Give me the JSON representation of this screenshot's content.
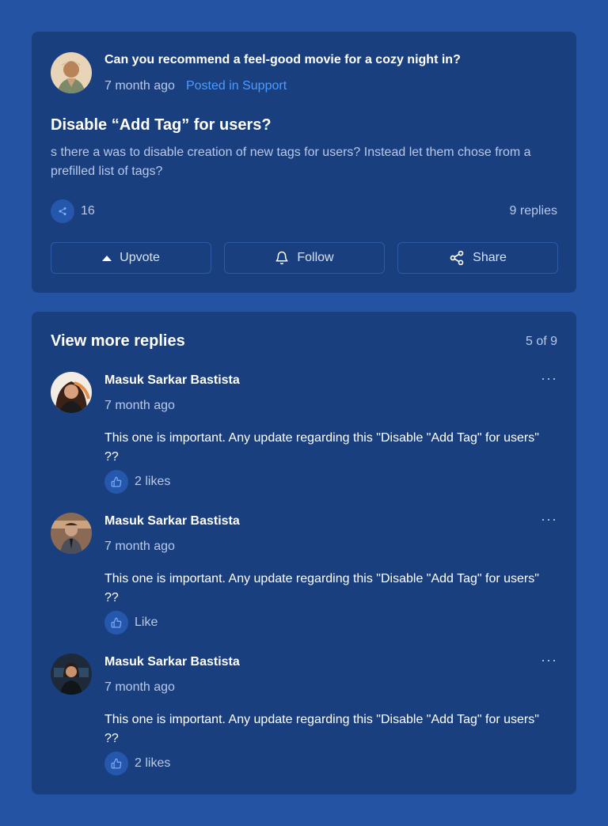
{
  "post": {
    "question": "Can you recommend a feel-good movie for a cozy night in?",
    "time": "7 month ago",
    "posted_in": "Posted in Support",
    "title": "Disable “Add Tag” for users?",
    "body": "s there a was to disable creation of new tags for users? Instead let them chose from a prefilled list of tags?",
    "share_count": "16",
    "replies_count": "9 replies",
    "actions": {
      "upvote": "Upvote",
      "follow": "Follow",
      "share": "Share"
    }
  },
  "replies_section": {
    "title": "View more replies",
    "pager": "5 of 9",
    "replies": [
      {
        "name": "Masuk Sarkar Bastista",
        "time": "7 month ago",
        "text": "This one is important. Any update regarding this \"Disable \"Add Tag\" for users\" ??",
        "likes": "2 likes"
      },
      {
        "name": "Masuk Sarkar Bastista",
        "time": "7 month ago",
        "text": "This one is important. Any update regarding this \"Disable \"Add Tag\" for users\" ??",
        "likes": "Like"
      },
      {
        "name": "Masuk Sarkar Bastista",
        "time": "7 month ago",
        "text": "This one is important. Any update regarding this \"Disable \"Add Tag\" for users\" ??",
        "likes": "2 likes"
      }
    ],
    "more_menu": "···"
  },
  "colors": {
    "page_bg": "#2453a3",
    "card_bg": "#1a3f7f",
    "accent": "#4d9bff",
    "muted_text": "#b8c9ec"
  }
}
